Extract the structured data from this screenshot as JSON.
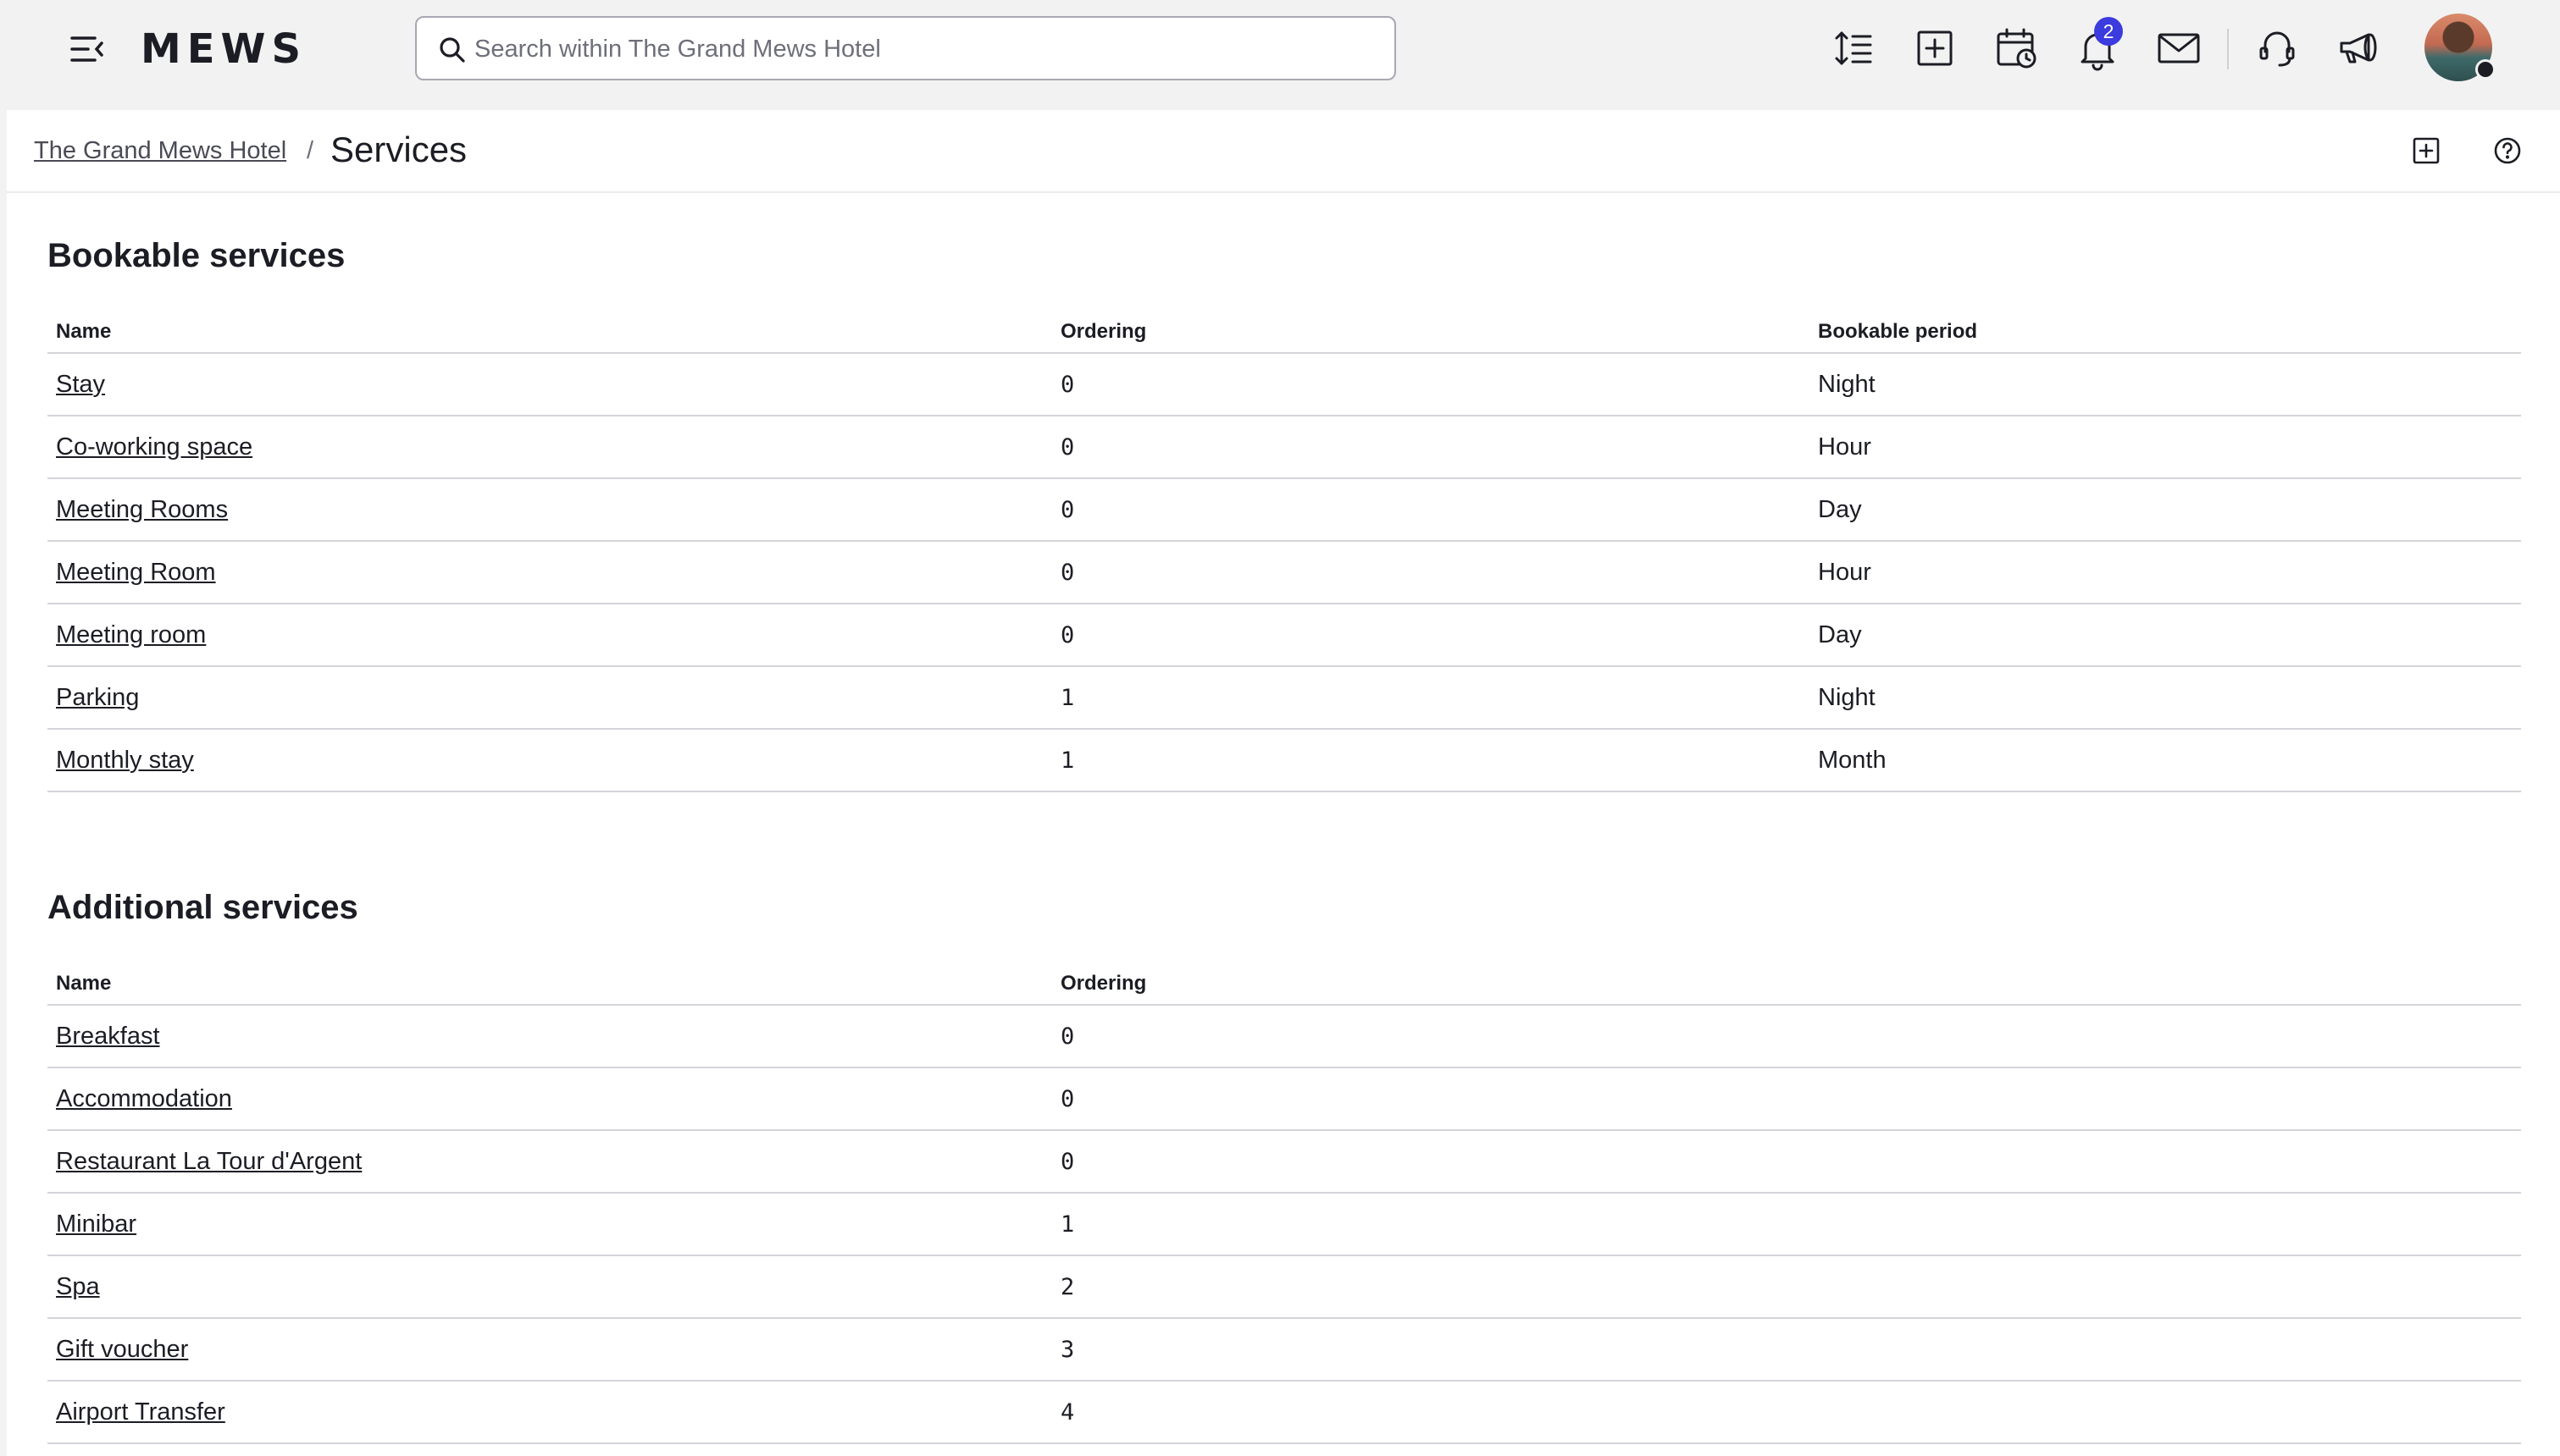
{
  "app": {
    "logo_text": "MEWS",
    "search_placeholder": "Search within The Grand Mews Hotel",
    "notifications_count": "2",
    "accent_color": "#3b3bde"
  },
  "header": {
    "breadcrumb_parent": "The Grand Mews Hotel",
    "breadcrumb_separator": "/",
    "title": "Services"
  },
  "bookable": {
    "title": "Bookable services",
    "columns": [
      "Name",
      "Ordering",
      "Bookable period"
    ],
    "rows": [
      {
        "name": "Stay",
        "ordering": "0",
        "period": "Night"
      },
      {
        "name": "Co-working space",
        "ordering": "0",
        "period": "Hour"
      },
      {
        "name": "Meeting Rooms",
        "ordering": "0",
        "period": "Day"
      },
      {
        "name": "Meeting Room",
        "ordering": "0",
        "period": "Hour"
      },
      {
        "name": "Meeting room",
        "ordering": "0",
        "period": "Day"
      },
      {
        "name": "Parking",
        "ordering": "1",
        "period": "Night"
      },
      {
        "name": "Monthly stay",
        "ordering": "1",
        "period": "Month"
      }
    ]
  },
  "additional": {
    "title": "Additional services",
    "columns": [
      "Name",
      "Ordering"
    ],
    "rows": [
      {
        "name": "Breakfast",
        "ordering": "0"
      },
      {
        "name": "Accommodation",
        "ordering": "0"
      },
      {
        "name": "Restaurant La Tour d'Argent",
        "ordering": "0"
      },
      {
        "name": "Minibar",
        "ordering": "1"
      },
      {
        "name": "Spa",
        "ordering": "2"
      },
      {
        "name": "Gift voucher",
        "ordering": "3"
      },
      {
        "name": "Airport Transfer",
        "ordering": "4"
      }
    ]
  },
  "icons": {
    "menu": "menu-collapse-icon",
    "search": "search-icon",
    "sort": "line-height-sort-icon",
    "add": "add-square-icon",
    "calendar": "calendar-clock-icon",
    "bell": "bell-icon",
    "mail": "mail-icon",
    "support": "headset-icon",
    "announcements": "megaphone-icon",
    "header_add": "add-square-icon",
    "help": "help-circle-icon"
  }
}
